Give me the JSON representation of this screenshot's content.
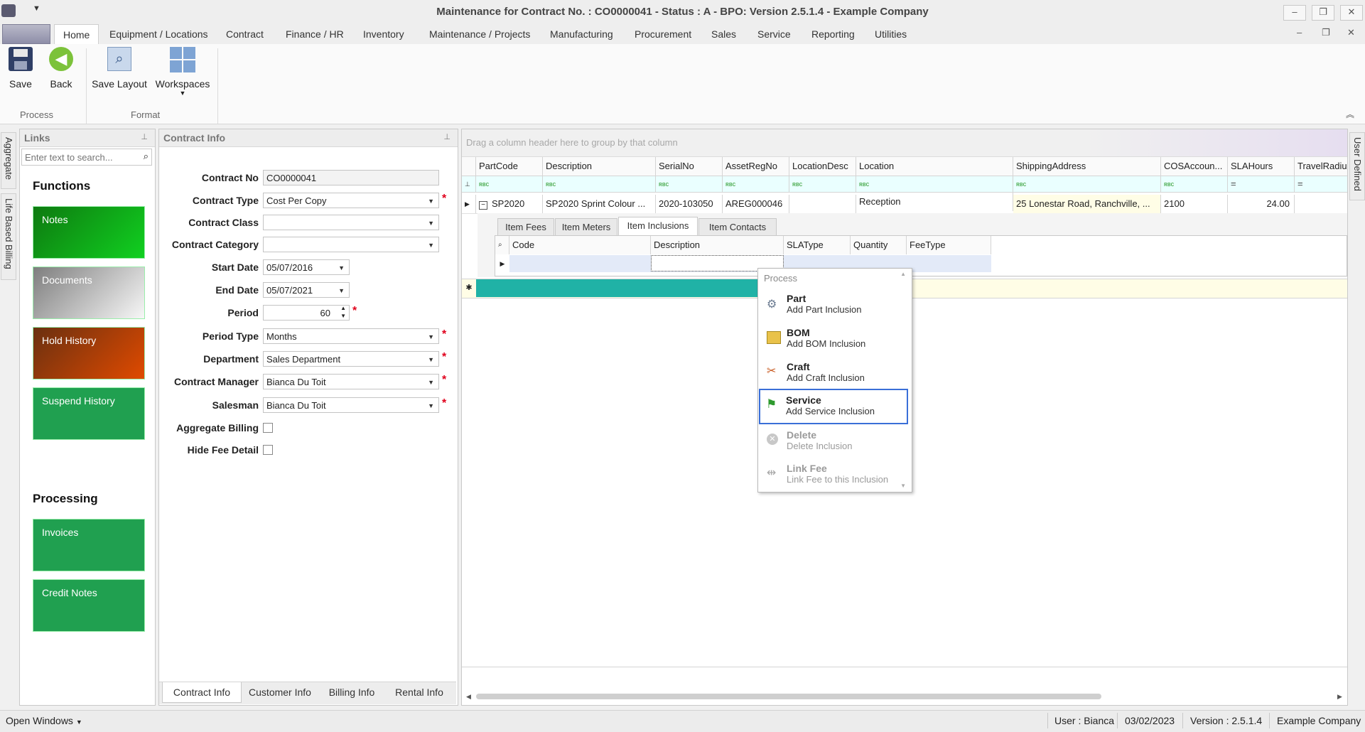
{
  "window": {
    "title": "Maintenance for Contract No. : CO0000041 - Status : A - BPO: Version 2.5.1.4 - Example Company",
    "minimize": "–",
    "restore": "❐",
    "close": "✕"
  },
  "menu": {
    "tabs": [
      "Home",
      "Equipment / Locations",
      "Contract",
      "Finance / HR",
      "Inventory",
      "Maintenance / Projects",
      "Manufacturing",
      "Procurement",
      "Sales",
      "Service",
      "Reporting",
      "Utilities"
    ]
  },
  "ribbon": {
    "save": "Save",
    "back": "Back",
    "save_layout": "Save Layout",
    "workspaces": "Workspaces",
    "group_process": "Process",
    "group_format": "Format"
  },
  "side_tabs": {
    "aggregate": "Aggregate",
    "life_billing": "Life Based Billing",
    "user_defined": "User Defined"
  },
  "links": {
    "title": "Links",
    "search_placeholder": "Enter text to search...",
    "functions_head": "Functions",
    "processing_head": "Processing",
    "functions": [
      {
        "label": "Notes",
        "color": "#1aa830"
      },
      {
        "label": "Documents",
        "color": "#bdbdbd"
      },
      {
        "label": "Hold History",
        "color": "#b03a10"
      },
      {
        "label": "Suspend History",
        "color": "#20a050"
      }
    ],
    "processing": [
      {
        "label": "Invoices",
        "color": "#20a050"
      },
      {
        "label": "Credit Notes",
        "color": "#20a050"
      }
    ]
  },
  "contract": {
    "title": "Contract Info",
    "fields": {
      "contract_no": {
        "label": "Contract No",
        "value": "CO0000041"
      },
      "contract_type": {
        "label": "Contract Type",
        "value": "Cost Per Copy"
      },
      "contract_class": {
        "label": "Contract Class",
        "value": ""
      },
      "contract_category": {
        "label": "Contract Category",
        "value": ""
      },
      "start_date": {
        "label": "Start Date",
        "value": "05/07/2016"
      },
      "end_date": {
        "label": "End Date",
        "value": "05/07/2021"
      },
      "period": {
        "label": "Period",
        "value": "60"
      },
      "period_type": {
        "label": "Period Type",
        "value": "Months"
      },
      "department": {
        "label": "Department",
        "value": "Sales Department"
      },
      "contract_manager": {
        "label": "Contract Manager",
        "value": "Bianca Du Toit"
      },
      "salesman": {
        "label": "Salesman",
        "value": "Bianca Du Toit"
      },
      "aggregate_billing": {
        "label": "Aggregate Billing",
        "checked": false
      },
      "hide_fee_detail": {
        "label": "Hide Fee Detail",
        "checked": false
      }
    },
    "required_mark": "*",
    "tabs": [
      "Contract Info",
      "Customer Info",
      "Billing Info",
      "Rental Info"
    ]
  },
  "grid": {
    "group_hint": "Drag a column header here to group by that column",
    "columns": [
      "PartCode",
      "Description",
      "SerialNo",
      "AssetRegNo",
      "LocationDesc",
      "Location",
      "ShippingAddress",
      "COSAccoun...",
      "SLAHours",
      "TravelRadiu"
    ],
    "row": {
      "PartCode": "SP2020",
      "Description": "SP2020 Sprint Colour ...",
      "SerialNo": "2020-103050",
      "AssetRegNo": "AREG000046",
      "LocationDesc": "",
      "Location": "Reception",
      "ShippingAddress": "25 Lonestar Road, Ranchville, ...",
      "COSAccount": "2100",
      "SLAHours": "24.00"
    },
    "sub_tabs": [
      "Item Fees",
      "Item Meters",
      "Item Inclusions",
      "Item Contacts"
    ],
    "sub_active": "Item Inclusions",
    "sub_columns": [
      "Code",
      "Description",
      "SLAType",
      "Quantity",
      "FeeType"
    ]
  },
  "popup": {
    "header": "Process",
    "items": [
      {
        "title": "Part",
        "sub": "Add Part Inclusion",
        "icon": "gears-icon",
        "enabled": true
      },
      {
        "title": "BOM",
        "sub": "Add BOM Inclusion",
        "icon": "bom-icon",
        "enabled": true
      },
      {
        "title": "Craft",
        "sub": "Add Craft Inclusion",
        "icon": "craft-icon",
        "enabled": true
      },
      {
        "title": "Service",
        "sub": "Add Service Inclusion",
        "icon": "flag-icon",
        "enabled": true,
        "selected": true
      },
      {
        "title": "Delete",
        "sub": "Delete Inclusion",
        "icon": "delete-icon",
        "enabled": false
      },
      {
        "title": "Link Fee",
        "sub": "Link Fee to this Inclusion",
        "icon": "link-icon",
        "enabled": false
      }
    ]
  },
  "status": {
    "open_windows": "Open Windows",
    "user": "User : Bianca",
    "date": "03/02/2023",
    "version": "Version : 2.5.1.4",
    "company": "Example Company"
  }
}
